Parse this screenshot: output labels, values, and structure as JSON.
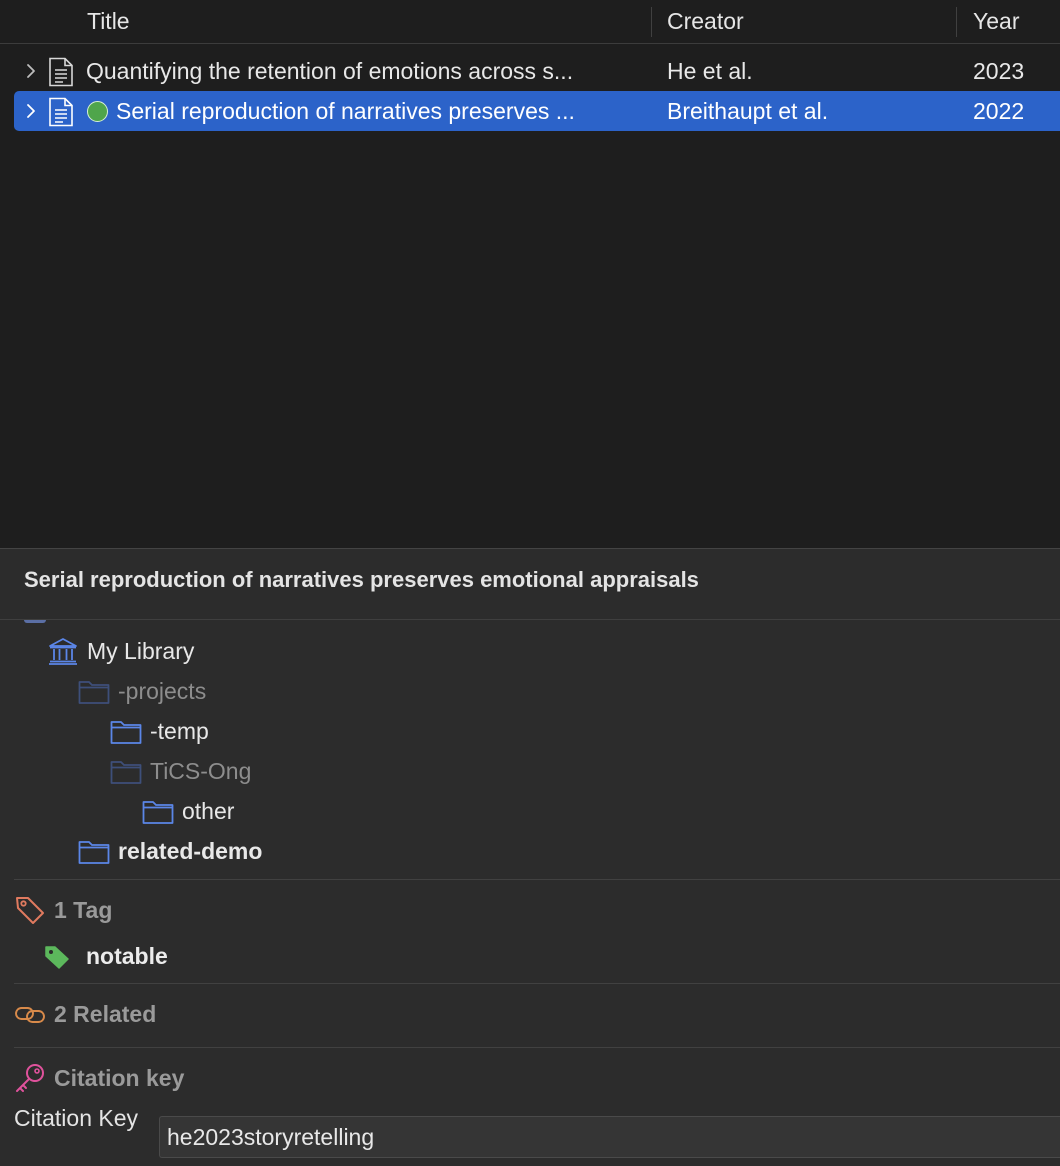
{
  "table": {
    "columns": {
      "title": "Title",
      "creator": "Creator",
      "year": "Year"
    },
    "rows": [
      {
        "title": "Quantifying the retention of emotions across s...",
        "creator": "He et al.",
        "year": "2023",
        "selected": false,
        "has_dot": false
      },
      {
        "title": "Serial reproduction of narratives preserves ...",
        "creator": "Breithaupt et al.",
        "year": "2022",
        "selected": true,
        "has_dot": true
      }
    ]
  },
  "item_pane": {
    "title": "Serial reproduction of narratives preserves emotional appraisals",
    "libraries": {
      "library": "My Library",
      "collections": [
        {
          "label": "-projects",
          "state": "dim"
        },
        {
          "label": "-temp",
          "state": "normal"
        },
        {
          "label": "TiCS-Ong",
          "state": "dim"
        },
        {
          "label": "other",
          "state": "normal"
        },
        {
          "label": "related-demo",
          "state": "bold"
        }
      ]
    },
    "tags": {
      "header": "1 Tag",
      "items": [
        "notable"
      ]
    },
    "related": {
      "header": "2 Related"
    },
    "citation": {
      "header": "Citation key",
      "field_label": "Citation Key",
      "value": "he2023storyretelling"
    }
  },
  "colors": {
    "selection": "#2c63c9",
    "folder": "#5b86e8",
    "tag_icon": "#5cb85c",
    "tags_section_icon": "#e07a5f",
    "related_section_icon": "#d88a4a",
    "citation_section_icon": "#e0529c"
  },
  "icons": {
    "twisty": "chevron-right-icon",
    "item_type": "document-icon",
    "library": "library-icon",
    "collection": "folder-icon",
    "tags_section": "tag-outline-icon",
    "tag": "tag-icon",
    "related_section": "link-icon",
    "citation_section": "key-icon"
  }
}
